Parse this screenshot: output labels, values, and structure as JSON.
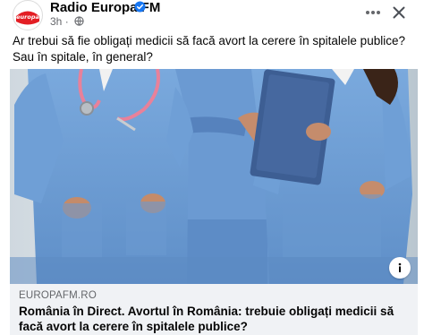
{
  "header": {
    "page_name": "Radio Europa FM",
    "avatar_logo_text": "europa",
    "time": "3h",
    "time_separator": "·"
  },
  "post": {
    "text": "Ar trebui să fie obligați medicii să facă avort la cerere în spitalele publice? Sau în spitale, în general?"
  },
  "link": {
    "domain": "EUROPAFM.RO",
    "title": "România în Direct. Avortul în România: trebuie obligați medicii să facă avort la cerere în spitalele publice?"
  },
  "icons": {
    "verified": "verified-badge-icon",
    "audience": "globe-icon",
    "more": "more-horizontal-icon",
    "close": "close-icon",
    "info": "info-icon"
  },
  "colors": {
    "brand_red": "#e31e24",
    "verified_blue": "#1877f2",
    "scrubs_blue": "#6e9fd6",
    "secondary_text": "#65676b",
    "link_bg": "#f0f2f5"
  }
}
